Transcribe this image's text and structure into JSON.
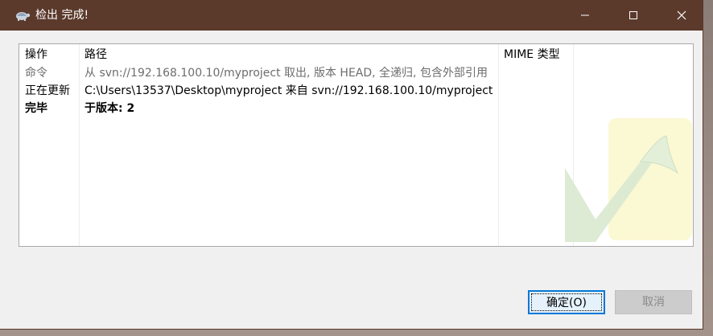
{
  "window": {
    "title": "检出 完成!",
    "app_icon": "tortoise-icon"
  },
  "titlebar_buttons": {
    "minimize_icon": "minimize-icon",
    "maximize_icon": "maximize-icon",
    "close_icon": "close-icon"
  },
  "list": {
    "headers": {
      "action": "操作",
      "path": "路径",
      "mime": "MIME 类型"
    },
    "rows": [
      {
        "action": "命令",
        "path": "从 svn://192.168.100.10/myproject 取出, 版本 HEAD, 全递归, 包含外部引用",
        "style": "gray"
      },
      {
        "action": "正在更新",
        "path": "C:\\Users\\13537\\Desktop\\myproject 来自 svn://192.168.100.10/myproject",
        "style": "normal"
      },
      {
        "action": "完毕",
        "path": "于版本: 2",
        "style": "bold"
      }
    ],
    "watermark_icon": "checkmark-watermark-icon"
  },
  "buttons": {
    "ok_label": "确定(O)",
    "cancel_label": "取消"
  },
  "colors": {
    "titlebar": "#5b3a2c",
    "focus_border": "#0078d7",
    "disabled_text": "#8a8a8a"
  }
}
